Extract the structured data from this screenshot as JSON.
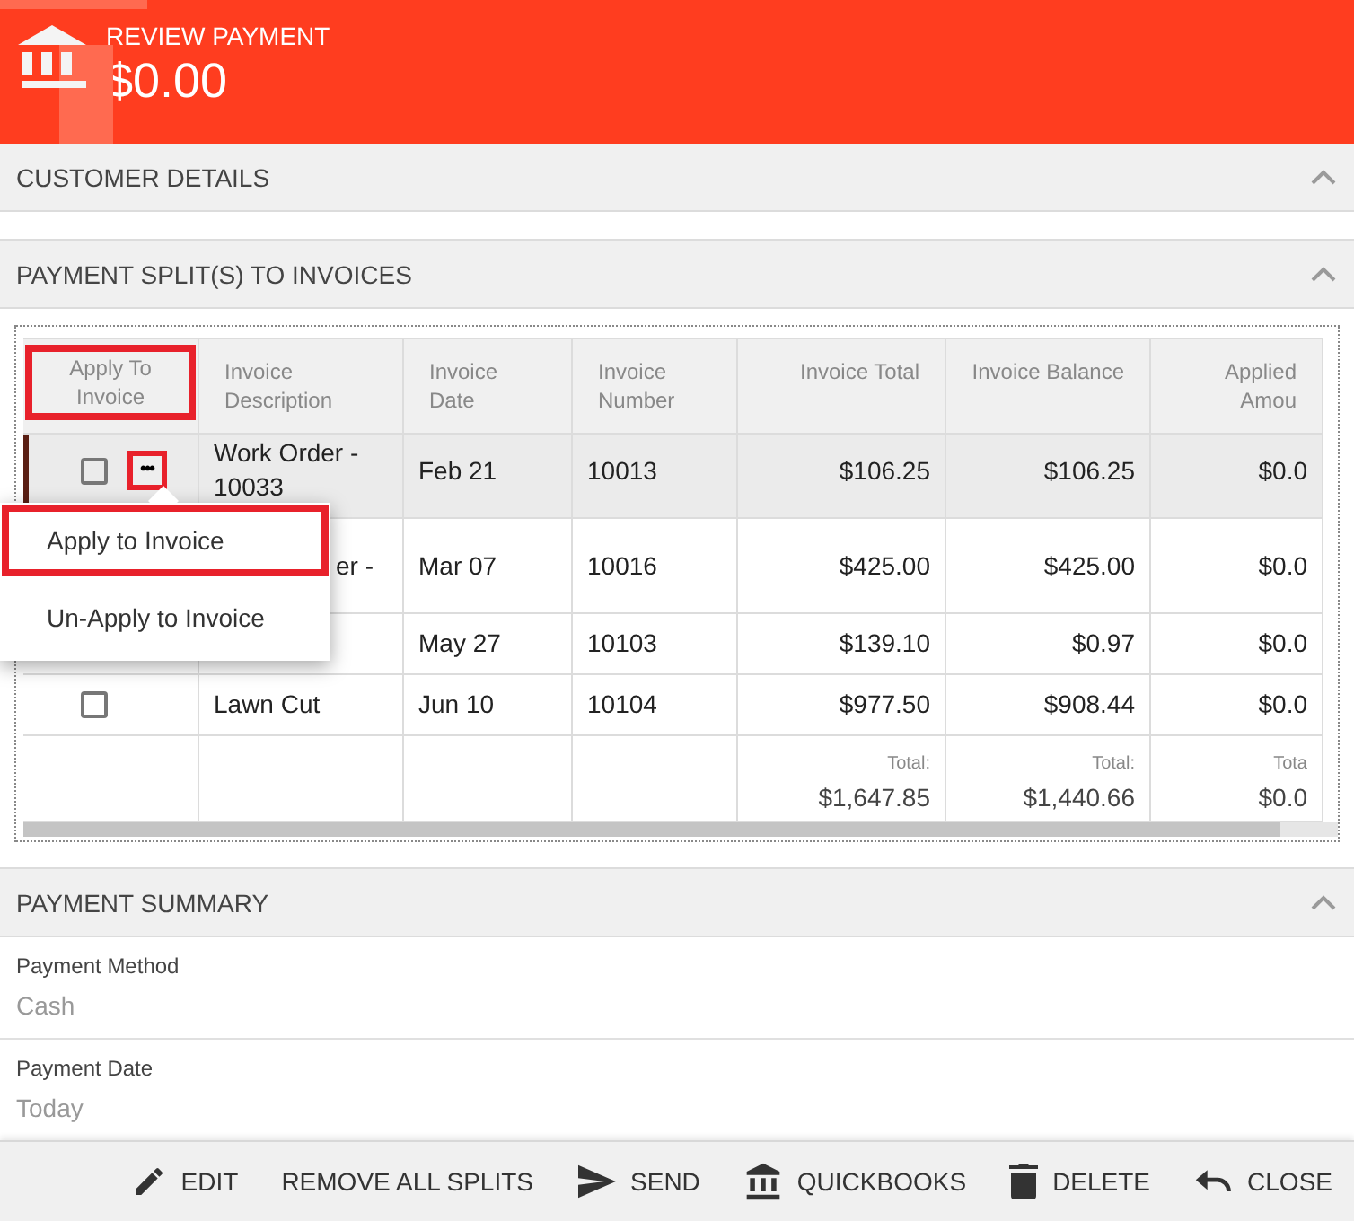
{
  "header": {
    "title": "REVIEW PAYMENT",
    "amount": "$0.00"
  },
  "customer_section": {
    "title": "CUSTOMER DETAILS"
  },
  "splits_section": {
    "title": "PAYMENT SPLIT(S) TO INVOICES",
    "table": {
      "columns": [
        {
          "label": "Apply To Invoice",
          "highlighted": true
        },
        {
          "label": "Invoice Description",
          "highlighted": false
        },
        {
          "label": "Invoice Date",
          "highlighted": false
        },
        {
          "label": "Invoice Number",
          "highlighted": false
        },
        {
          "label": "Invoice Total",
          "highlighted": false
        },
        {
          "label": "Invoice Balance",
          "highlighted": false
        },
        {
          "label": "Applied Amou",
          "highlighted": false
        }
      ],
      "rows": [
        {
          "selected": true,
          "checked": false,
          "more_button": {
            "label": "•••",
            "highlighted": true
          },
          "cells": [
            "",
            "Work Order - 10033",
            "Feb 21",
            "10013",
            "$106.25",
            "$106.25",
            "$0.0"
          ]
        },
        {
          "selected": false,
          "cells": [
            "",
            "er -",
            "Mar 07",
            "10016",
            "$425.00",
            "$425.00",
            "$0.0"
          ]
        },
        {
          "selected": false,
          "cells": [
            "",
            "",
            "May 27",
            "10103",
            "$139.10",
            "$0.97",
            "$0.0"
          ]
        },
        {
          "selected": false,
          "checked": false,
          "cells": [
            "",
            "Lawn Cut",
            "Jun 10",
            "10104",
            "$977.50",
            "$908.44",
            "$0.0"
          ]
        }
      ],
      "totals": [
        {
          "label": "Total:",
          "value": "$1,647.85"
        },
        {
          "label": "Total:",
          "value": "$1,440.66"
        },
        {
          "label": "Tota",
          "value": "$0.0"
        }
      ]
    },
    "menu": [
      {
        "label": "Apply to Invoice",
        "highlighted": true
      },
      {
        "label": "Un-Apply to Invoice",
        "highlighted": false
      }
    ]
  },
  "summary_section": {
    "title": "PAYMENT SUMMARY",
    "fields": [
      {
        "label": "Payment Method",
        "value": "Cash"
      },
      {
        "label": "Payment Date",
        "value": "Today"
      }
    ]
  },
  "footer_actions": [
    {
      "kind": "edit",
      "label": "EDIT"
    },
    {
      "kind": "text",
      "label": "REMOVE ALL SPLITS"
    },
    {
      "kind": "send",
      "label": "SEND"
    },
    {
      "kind": "bank",
      "label": "QUICKBOOKS"
    },
    {
      "kind": "delete",
      "label": "DELETE"
    },
    {
      "kind": "undo",
      "label": "CLOSE"
    }
  ]
}
